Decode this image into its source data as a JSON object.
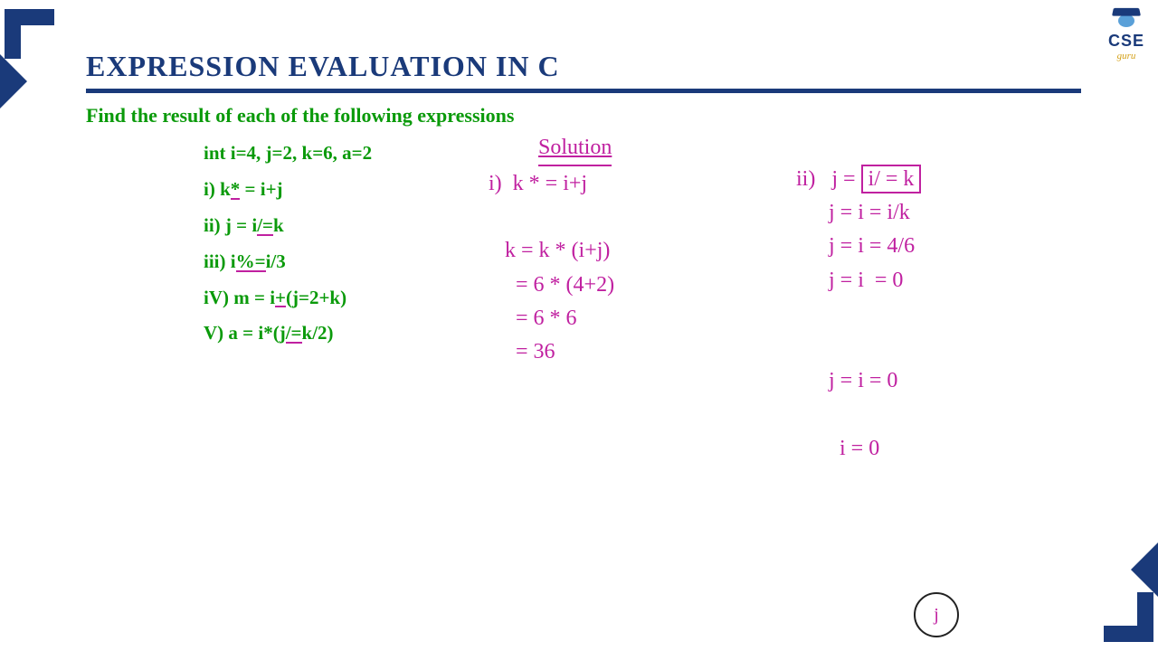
{
  "logo": {
    "line1": "CSE",
    "line2": "guru"
  },
  "title": "EXPRESSION EVALUATION IN C",
  "subtitle": "Find the result of each of the following expressions",
  "problems": {
    "decl": "int i=4, j=2, k=6, a=2",
    "p1_a": "i) k",
    "p1_b": "*",
    "p1_c": " = i+j",
    "p2_a": "ii) j = i",
    "p2_b": "/=",
    "p2_c": "k",
    "p3_a": "iii) i",
    "p3_b": "%=",
    "p3_c": "i/3",
    "p4_a": "iV) m = i",
    "p4_b": "+",
    "p4_c": "(j=2+k)",
    "p5_a": "V) a = i*(j",
    "p5_b": "/=",
    "p5_c": "k/2)"
  },
  "solution": {
    "label": "Solution",
    "s1": "i)  k * = i+j\n\n   k = k * (i+j)\n     = 6 * (4+2)\n     = 6 * 6\n     = 36",
    "s2_hdr_a": "ii)   j = ",
    "s2_hdr_b": "i/ = k",
    "s2_body": "\n      j = i = i/k\n      j = i = 4/6\n      j = i  = 0\n\n\n      j = i = 0\n\n        i = 0",
    "cursor": "j"
  }
}
